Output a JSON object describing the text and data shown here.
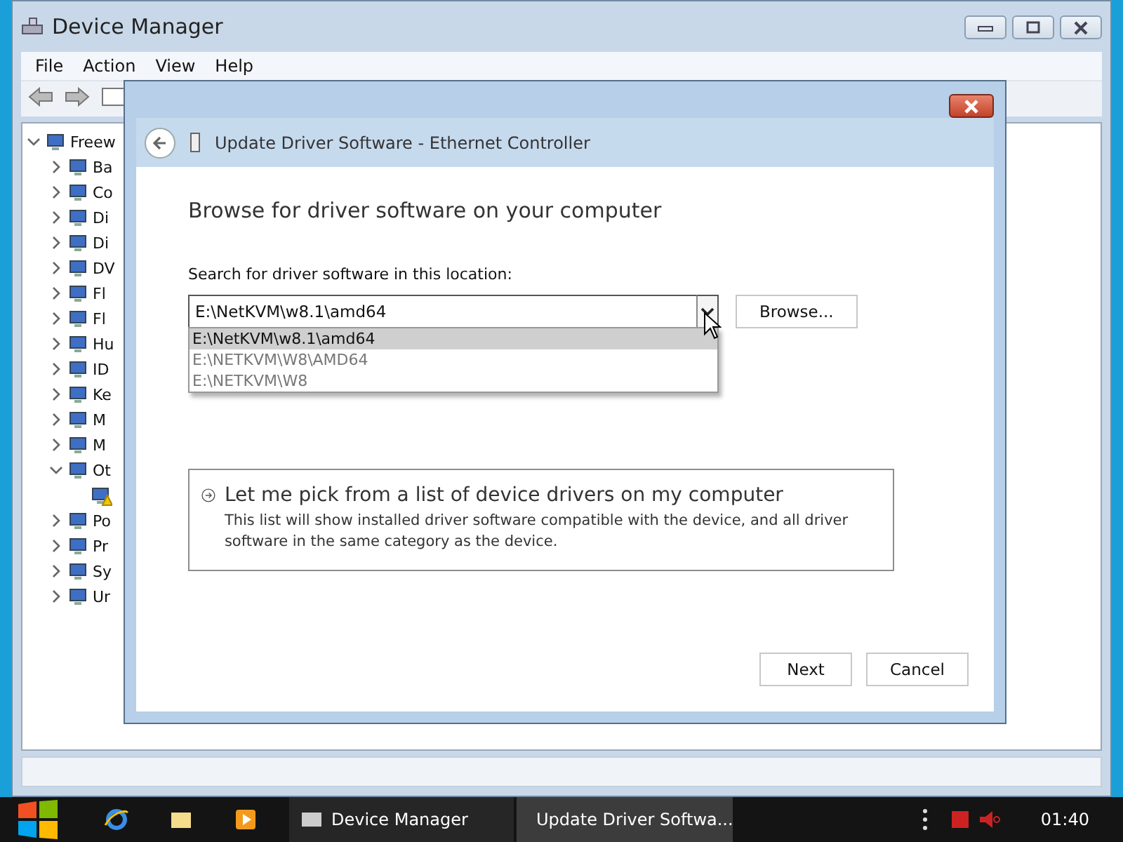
{
  "main_window": {
    "title": "Device Manager",
    "menu": [
      "File",
      "Action",
      "View",
      "Help"
    ],
    "tree": {
      "label": "Freew",
      "expanded": true,
      "children": [
        {
          "label": "Ba",
          "expanded": false
        },
        {
          "label": "Co",
          "expanded": false
        },
        {
          "label": "Di",
          "expanded": false
        },
        {
          "label": "Di",
          "expanded": false
        },
        {
          "label": "DV",
          "expanded": false
        },
        {
          "label": "Fl",
          "expanded": false
        },
        {
          "label": "Fl",
          "expanded": false
        },
        {
          "label": "Hu",
          "expanded": false
        },
        {
          "label": "ID",
          "expanded": false
        },
        {
          "label": "Ke",
          "expanded": false
        },
        {
          "label": "M",
          "expanded": false
        },
        {
          "label": "M",
          "expanded": false
        },
        {
          "label": "Ot",
          "expanded": true,
          "children": [
            {
              "warning": true
            }
          ]
        },
        {
          "label": "Po",
          "expanded": false
        },
        {
          "label": "Pr",
          "expanded": false
        },
        {
          "label": "Sy",
          "expanded": false
        },
        {
          "label": "Ur",
          "expanded": false
        }
      ]
    }
  },
  "dialog": {
    "title": "Update Driver Software - Ethernet Controller",
    "heading": "Browse for driver software on your computer",
    "location_label": "Search for driver software in this location:",
    "location_value": "E:\\NetKVM\\w8.1\\amd64",
    "suggestions": [
      {
        "text": "E:\\NetKVM\\w8.1\\amd64",
        "selected": true
      },
      {
        "text": "E:\\NETKVM\\W8\\AMD64",
        "selected": false
      },
      {
        "text": "E:\\NETKVM\\W8",
        "selected": false
      }
    ],
    "browse_button": "Browse...",
    "option": {
      "title": "Let me pick from a list of device drivers on my computer",
      "description": "This list will show installed driver software compatible with the device, and all driver software in the same category as the device."
    },
    "buttons": [
      "Next",
      "Cancel"
    ]
  },
  "taskbar": {
    "tasks": [
      {
        "label": "Device Manager",
        "selected": false
      },
      {
        "label": "Update Driver Softwa...",
        "selected": true
      }
    ],
    "clock": "01:40"
  }
}
